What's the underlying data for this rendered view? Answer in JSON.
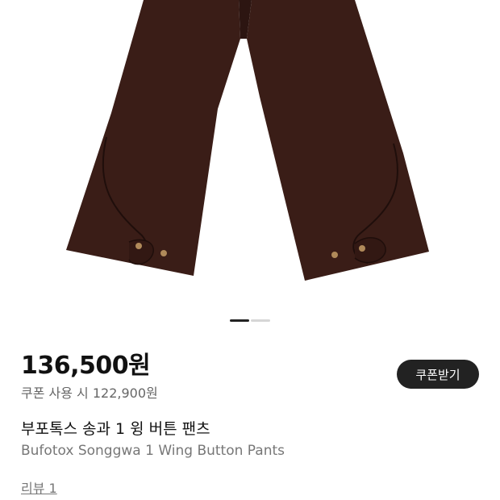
{
  "product": {
    "image_subject": "brown wide-leg pants",
    "price": "136,500원",
    "coupon_price": "쿠폰 사용 시 122,900원",
    "coupon_button": "쿠폰받기",
    "name_ko": "부포톡스 송과 1 윙 버튼 팬츠",
    "name_en": "Bufotox Songgwa 1 Wing Button Pants",
    "review_link": "리뷰 1"
  },
  "carousel": {
    "pages": 2,
    "active_index": 0
  },
  "colors": {
    "pants": "#3a1d17",
    "coupon_button_bg": "#222222",
    "indicator_active": "#222222",
    "indicator_inactive": "#d6d6d6"
  }
}
